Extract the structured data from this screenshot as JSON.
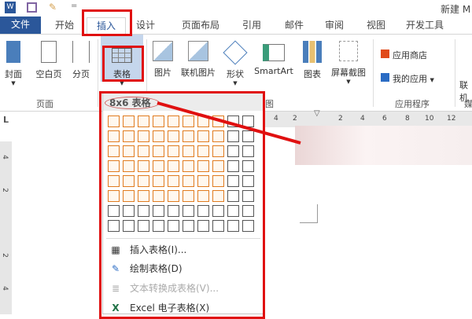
{
  "title_bar": {
    "doc_title": "新建 M",
    "qat_more": "="
  },
  "tabs": [
    {
      "label": "文件"
    },
    {
      "label": "开始"
    },
    {
      "label": "插入"
    },
    {
      "label": "设计"
    },
    {
      "label": "页面布局"
    },
    {
      "label": "引用"
    },
    {
      "label": "邮件"
    },
    {
      "label": "审阅"
    },
    {
      "label": "视图"
    },
    {
      "label": "开发工具"
    }
  ],
  "ribbon": {
    "pages_group": {
      "label": "页面",
      "buttons": [
        "封面",
        "空白页",
        "分页"
      ]
    },
    "table_button": "表格",
    "illustrations": {
      "label": "插图",
      "buttons": [
        "图片",
        "联机图片",
        "形状",
        "SmartArt",
        "图表",
        "屏幕截图"
      ]
    },
    "apps_group": {
      "label": "应用程序",
      "store": "应用商店",
      "my_apps": "我的应用"
    },
    "media_partial": {
      "button": "联机",
      "label": "媒"
    }
  },
  "ruler": {
    "h_ticks": [
      "4",
      "2",
      "2",
      "4",
      "6",
      "8",
      "10",
      "12"
    ],
    "v_ticks": [
      "4",
      "2",
      "2",
      "4"
    ],
    "corner": "L"
  },
  "table_menu": {
    "header": "8x6 表格",
    "grid": {
      "columns": 10,
      "rows": 8,
      "selected_columns": 8,
      "selected_rows": 6
    },
    "items": [
      {
        "label": "插入表格(I)...",
        "icon": "table-grid-icon",
        "enabled": true
      },
      {
        "label": "绘制表格(D)",
        "icon": "draw-table-icon",
        "enabled": true
      },
      {
        "label": "文本转换成表格(V)...",
        "icon": "text-to-table-icon",
        "enabled": false
      },
      {
        "label": "Excel 电子表格(X)",
        "icon": "excel-icon",
        "enabled": true
      }
    ]
  },
  "colors": {
    "accent": "#2b579a",
    "highlight": "#e01010",
    "grid_selected": "#e07b1f"
  }
}
